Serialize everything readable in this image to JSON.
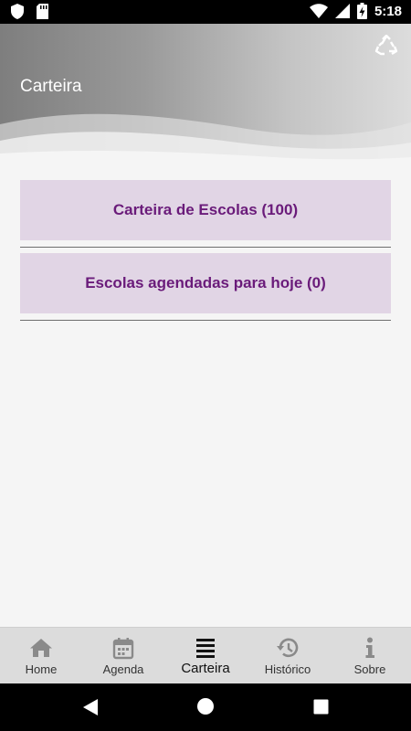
{
  "status_bar": {
    "time": "5:18"
  },
  "header": {
    "title": "Carteira"
  },
  "cards": [
    {
      "label": "Carteira de Escolas (100)"
    },
    {
      "label": "Escolas agendadas para hoje (0)"
    }
  ],
  "bottom_nav": {
    "active": "Carteira",
    "items": [
      {
        "label": "Home",
        "icon": "home-icon"
      },
      {
        "label": "Agenda",
        "icon": "calendar-icon"
      },
      {
        "label": "Carteira",
        "icon": "list-icon"
      },
      {
        "label": "Histórico",
        "icon": "history-icon"
      },
      {
        "label": "Sobre",
        "icon": "info-icon"
      }
    ]
  },
  "colors": {
    "card_background": "#e1d5e5",
    "card_text": "#6a1b7a",
    "nav_background": "#dcdcdc",
    "nav_inactive_icon": "#8a8a8a",
    "nav_active_icon": "#111111"
  }
}
